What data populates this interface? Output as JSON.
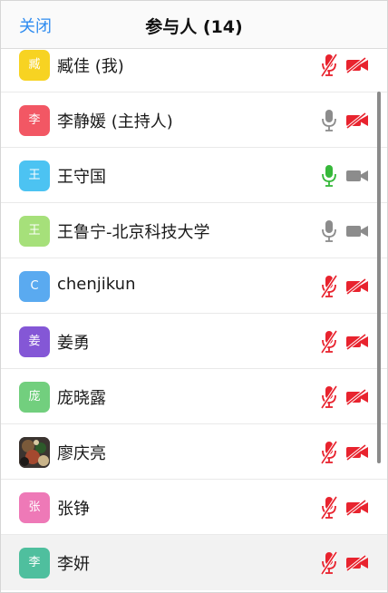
{
  "header": {
    "close_label": "关闭",
    "title": "参与人 (14)"
  },
  "participants": [
    {
      "name": "臧佳 (我)",
      "avatar_text": "臧",
      "avatar_color": "#f7d322",
      "mic": "muted",
      "camera": "off"
    },
    {
      "name": "李静媛 (主持人)",
      "avatar_text": "李",
      "avatar_color": "#f25764",
      "mic": "on",
      "camera": "off"
    },
    {
      "name": "王守国",
      "avatar_text": "王",
      "avatar_color": "#4cc3f2",
      "mic": "active",
      "camera": "on"
    },
    {
      "name": "王鲁宁-北京科技大学",
      "avatar_text": "王",
      "avatar_color": "#a6e07a",
      "mic": "on",
      "camera": "on"
    },
    {
      "name": "chenjikun",
      "avatar_text": "C",
      "avatar_color": "#5aaaf0",
      "mic": "muted",
      "camera": "off"
    },
    {
      "name": "姜勇",
      "avatar_text": "姜",
      "avatar_color": "#8457d6",
      "mic": "muted",
      "camera": "off"
    },
    {
      "name": "庞晓露",
      "avatar_text": "庞",
      "avatar_color": "#72cf7e",
      "mic": "muted",
      "camera": "off"
    },
    {
      "name": "廖庆亮",
      "avatar_text": "",
      "avatar_color": "#3b3430",
      "avatar_type": "photo",
      "mic": "muted",
      "camera": "off"
    },
    {
      "name": "张铮",
      "avatar_text": "张",
      "avatar_color": "#ee79b7",
      "mic": "muted",
      "camera": "off"
    },
    {
      "name": "李妍",
      "avatar_text": "李",
      "avatar_color": "#4fbf9e",
      "mic": "muted",
      "camera": "off"
    }
  ],
  "colors": {
    "accent": "#2f8cf0",
    "muted_red": "#e8232e",
    "icon_gray": "#8c8c8c",
    "speaking_green": "#36b83a"
  }
}
